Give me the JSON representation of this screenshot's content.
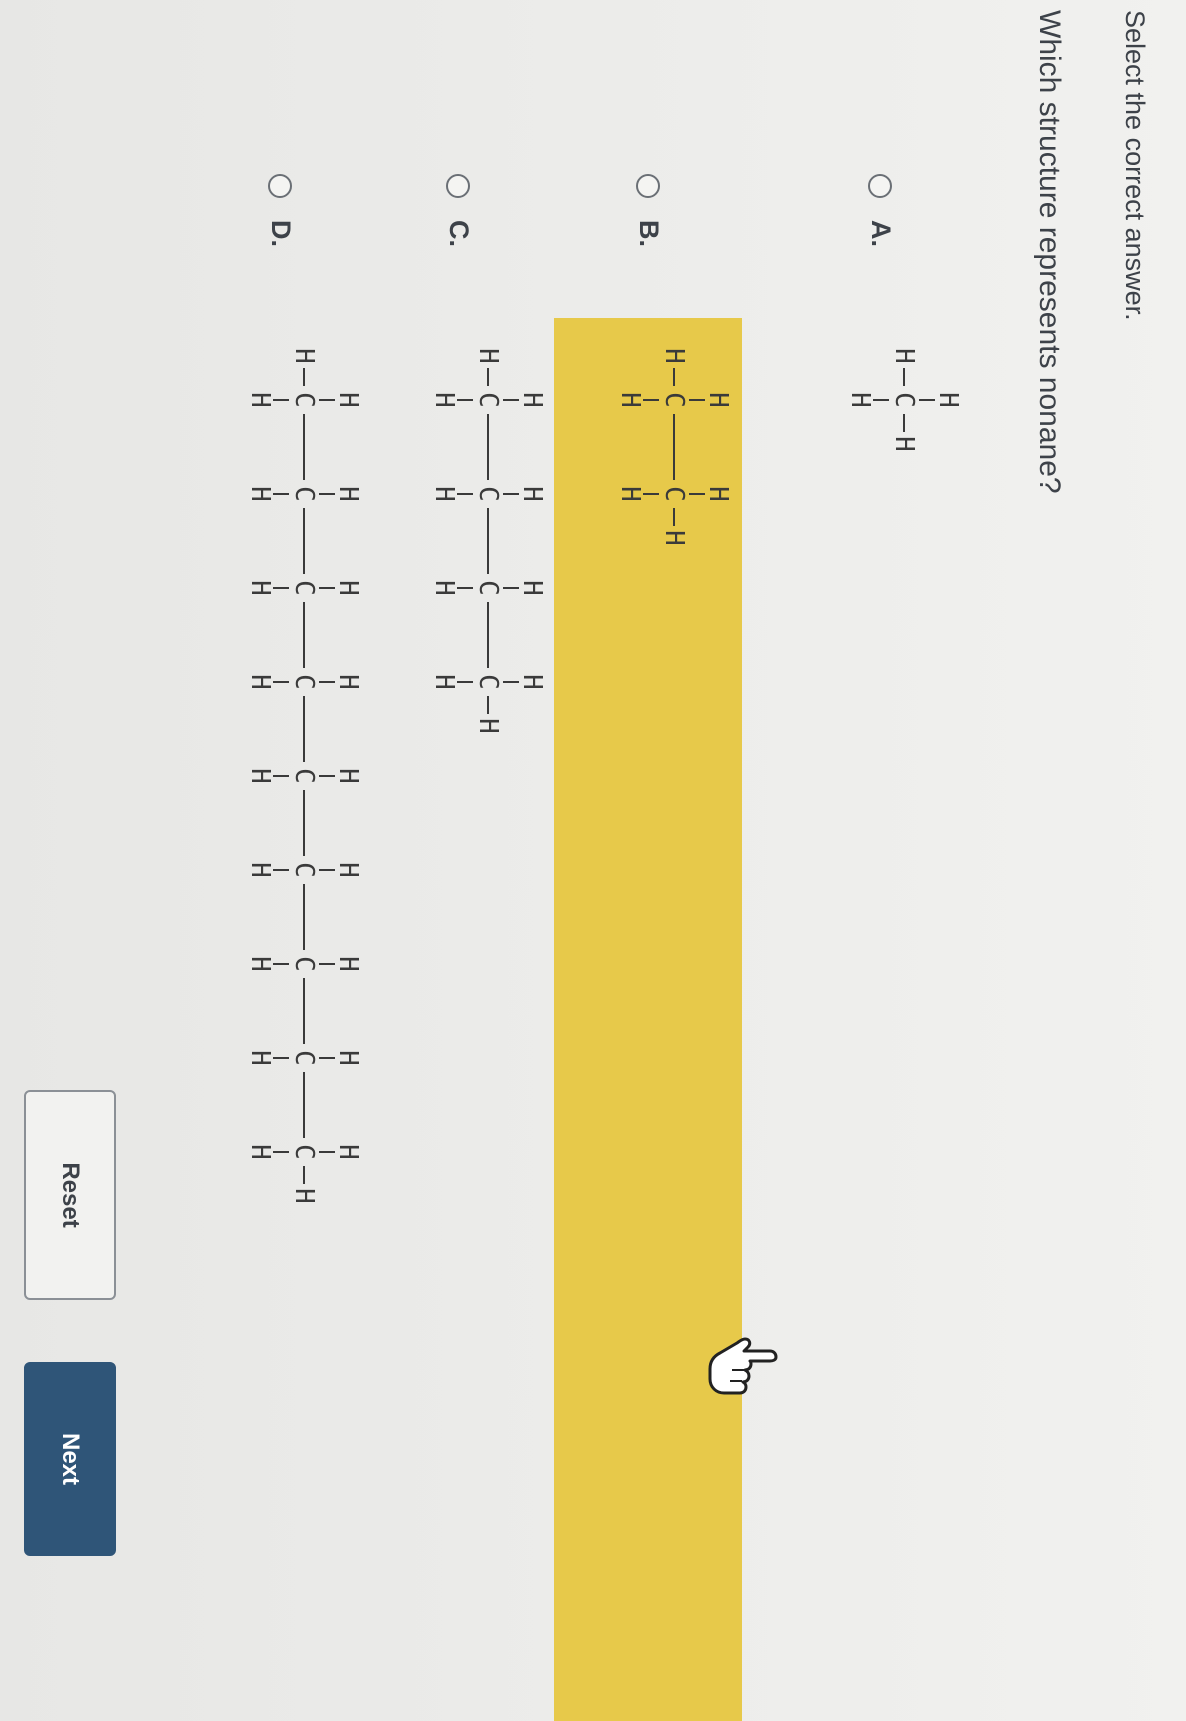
{
  "instruction": "Select the correct answer.",
  "question": "Which structure represents nonane?",
  "options": [
    {
      "label": "A.",
      "carbons": 1
    },
    {
      "label": "B.",
      "carbons": 2
    },
    {
      "label": "C.",
      "carbons": 4
    },
    {
      "label": "D.",
      "carbons": 9
    }
  ],
  "atoms": {
    "carbon": "C",
    "hydrogen": "H"
  },
  "buttons": {
    "reset": "Reset",
    "next": "Next"
  },
  "cursor_icon": "pointing-hand-icon",
  "colors": {
    "highlight": "#e7c94a",
    "next_button": "#2f5578",
    "text": "#3d4249"
  }
}
